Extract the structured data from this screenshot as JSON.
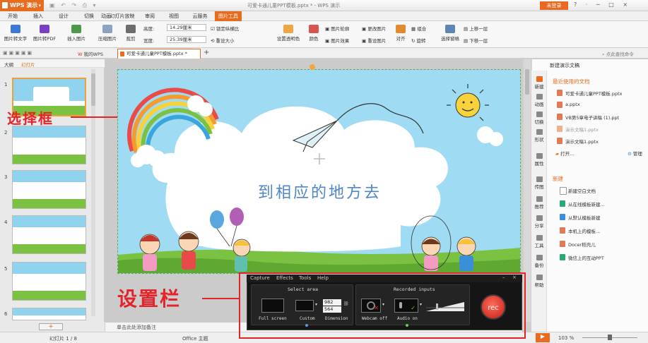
{
  "app": {
    "name": "WPS 演示",
    "doc_title": "可爱卡通儿童PPT模板.pptx * - WPS 演示",
    "login": "未登录",
    "window_controls": "? · ─ □ ×"
  },
  "menu": {
    "tabs": [
      "开始",
      "插入",
      "设计",
      "切换",
      "动画",
      "幻灯片放映",
      "审阅",
      "视图",
      "云服务",
      "图片工具"
    ],
    "active": "图片工具"
  },
  "ribbon": {
    "pic_to_text": "图片转文字",
    "pic_to_pdf": "图片转PDF",
    "insert_pic": "插入图片",
    "compress": "压缩图片",
    "crop": "裁剪",
    "height_label": "高度:",
    "height_value": "14.29厘米",
    "width_label": "宽度:",
    "width_value": "25.39厘米",
    "lock_ratio": "锁定纵横比",
    "reset_size": "重设大小",
    "set_transparent": "设置透明色",
    "color": "颜色",
    "pic_outline": "图片轮廓",
    "pic_effect": "图片效果",
    "change_pic": "更改图片",
    "reset_pic": "重设图片",
    "align": "对齐",
    "group": "组合",
    "rotate": "旋转",
    "select_pane": "选择窗格",
    "bring_forward": "上移一层",
    "send_back": "下移一层"
  },
  "docbar": {
    "my_wps": "我的WPS",
    "doc_tab": "可爱卡通儿童PPT模板.pptx *",
    "add_tab": "+",
    "search": "点此查找命令"
  },
  "left_panel": {
    "tab_outline": "大纲",
    "tab_slides": "幻灯片",
    "slide_numbers": [
      "1",
      "2",
      "3",
      "4",
      "5",
      "6"
    ],
    "add_button": "+"
  },
  "slide": {
    "title": "到相应的地方去"
  },
  "notes_placeholder": "单击此处添加备注",
  "right_panel": {
    "header": "新建演示文稿",
    "recent_title": "最近使用的文档",
    "recent": [
      "可爱卡通儿童PPT模板.pptx",
      "a.pptx",
      "VB第5章电子讲稿 (1).ppt",
      "演示文稿1.pptx",
      "演示文稿1.pptx"
    ],
    "open": "打开...",
    "manage": "管理",
    "new_title": "新建",
    "new_items": [
      "新建空白文档",
      "从在线模板新建...",
      "从默认模板新建",
      "本机上的模板...",
      "Docer稻壳儿",
      "微信上的互动PPT"
    ]
  },
  "side_icons": [
    "新建",
    "动画",
    "切换",
    "形状",
    "属性",
    "传图",
    "推荐",
    "分享",
    "工具",
    "备份",
    "帮助"
  ],
  "status": {
    "slide_pos": "幻灯片 1 / 8",
    "theme": "Office 主题",
    "zoom": "103 %"
  },
  "labels": {
    "select_frame": "选择框",
    "settings_bar": "设置栏"
  },
  "recorder": {
    "menu": [
      "Capture",
      "Effects",
      "Tools",
      "Help"
    ],
    "select_area": "Select area",
    "recorded_inputs": "Recorded inputs",
    "full_screen": "Full screen",
    "custom": "Custom",
    "dimension": "Dimension",
    "width": "982",
    "height": "564",
    "webcam": "Webcam off",
    "audio": "Audio on",
    "rec": "rec"
  }
}
